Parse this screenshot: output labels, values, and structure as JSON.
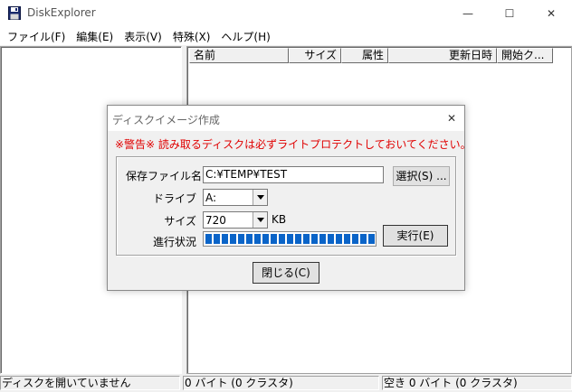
{
  "window": {
    "title": "DiskExplorer",
    "minimize_glyph": "—",
    "maximize_glyph": "☐",
    "close_glyph": "✕"
  },
  "menu": [
    {
      "label": "ファイル(F)"
    },
    {
      "label": "編集(E)"
    },
    {
      "label": "表示(V)"
    },
    {
      "label": "特殊(X)"
    },
    {
      "label": "ヘルプ(H)"
    }
  ],
  "file_list": {
    "columns": [
      "名前",
      "サイズ",
      "属性",
      "更新日時",
      "開始ク..."
    ]
  },
  "status": {
    "disk": "ディスクを開いていません",
    "selection": "0 バイト (0 クラスタ)",
    "free": "空き 0 バイト (0 クラスタ)"
  },
  "dialog": {
    "title": "ディスクイメージ作成",
    "close_glyph": "✕",
    "warning": "※警告※ 読み取るディスクは必ずライトプロテクトしておいてください。",
    "filename_label": "保存ファイル名",
    "filename_value": "C:¥TEMP¥TEST",
    "select_button": "選択(S) ...",
    "drive_label": "ドライブ",
    "drive_value": "A:",
    "size_label": "サイズ",
    "size_value": "720",
    "size_unit": "KB",
    "progress_label": "進行状況",
    "progress_fraction": 1.0,
    "execute_button": "実行(E)",
    "close_button": "閉じる(C)"
  }
}
